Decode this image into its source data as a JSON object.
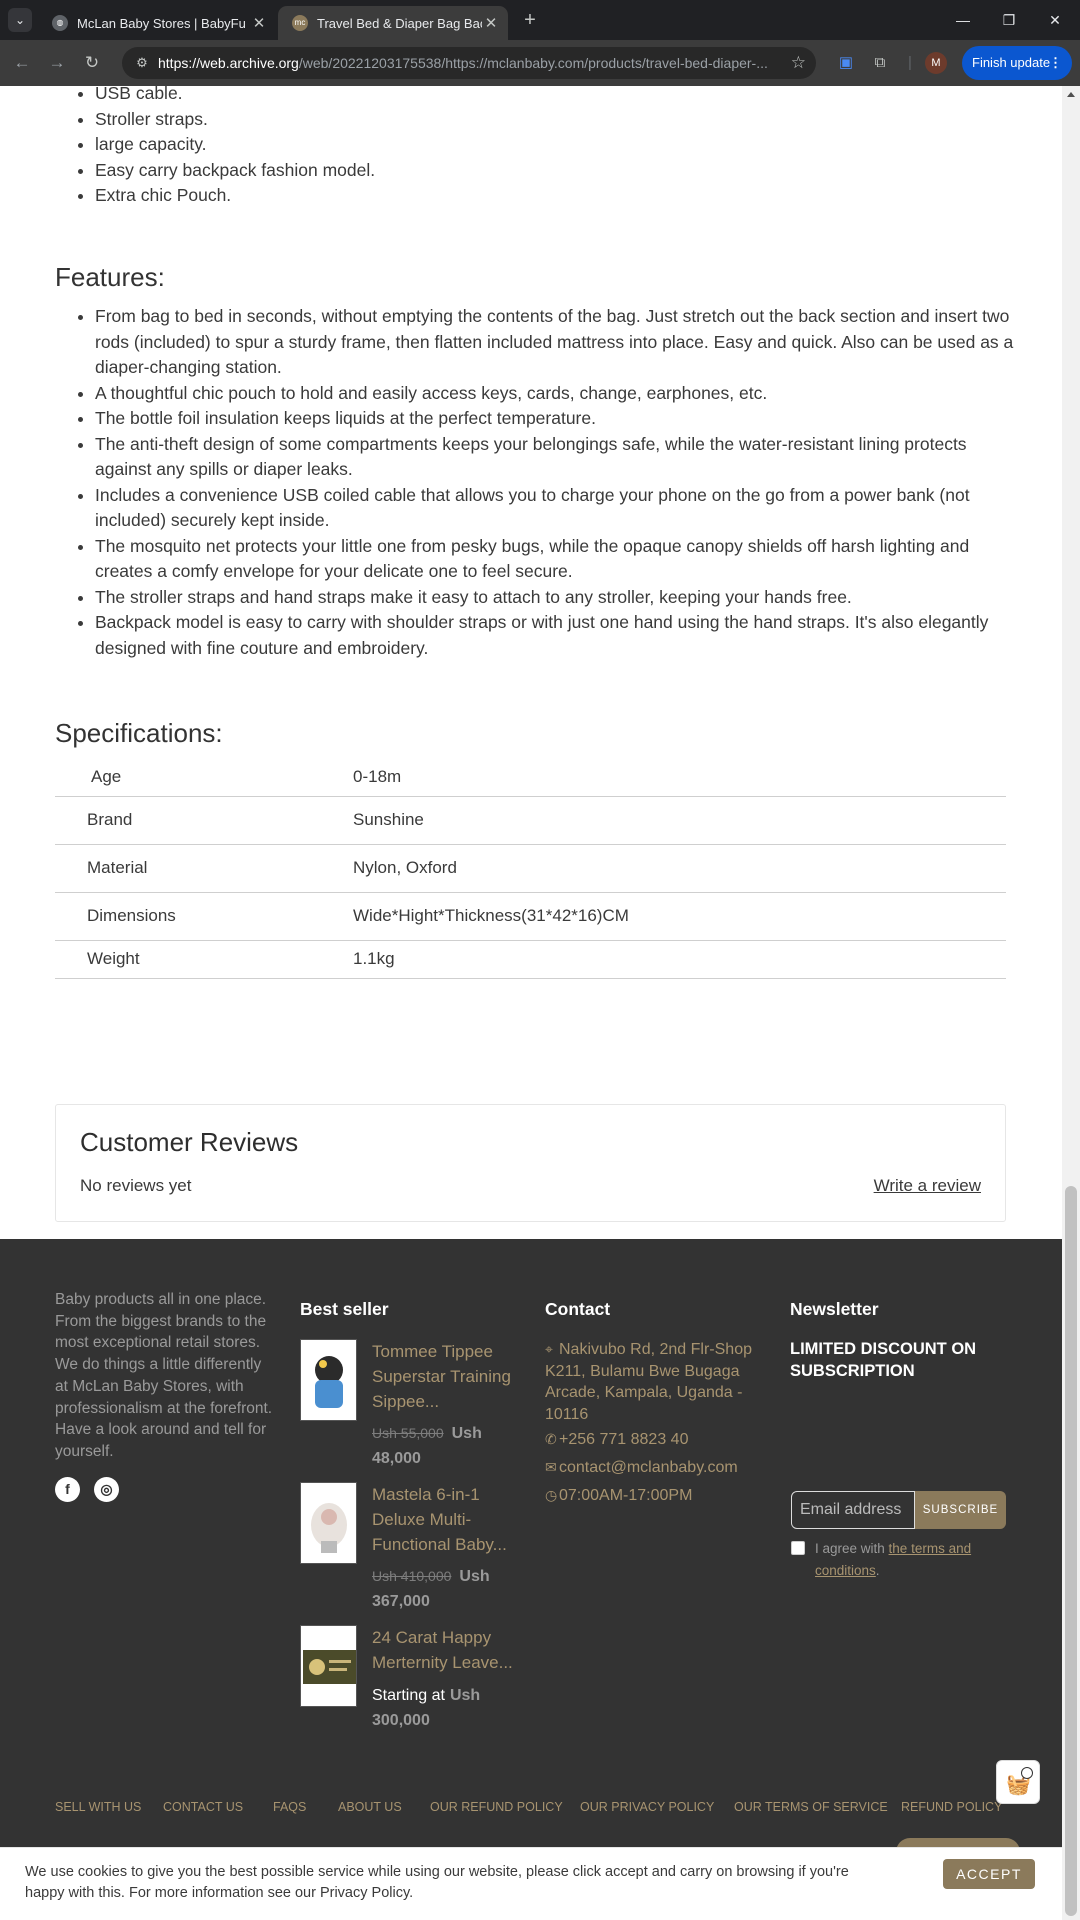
{
  "browser": {
    "tabs": [
      {
        "title": "McLan Baby Stores | BabyFu - M",
        "favicon": "globe-icon"
      },
      {
        "title": "Travel Bed & Diaper Bag Backpack",
        "favicon": "mc"
      }
    ],
    "url_host": "https://web.archive.org",
    "url_path": "/web/20221203175538/https://mclanbaby.com/products/travel-bed-diaper-...",
    "profile_initial": "M",
    "finish_update_label": "Finish update"
  },
  "page": {
    "top_list": [
      "USB cable.",
      "Stroller straps.",
      "large capacity.",
      "Easy carry backpack fashion model.",
      "Extra chic Pouch."
    ],
    "features_heading": "Features:",
    "features": [
      "From bag to bed in seconds, without emptying the contents of the bag. Just stretch out the back section and insert two rods (included) to spur a sturdy frame, then flatten included mattress into place. Easy and quick. Also can be used as a diaper-changing station.",
      "A thoughtful chic pouch to hold and easily access keys, cards, change, earphones, etc.",
      "The bottle foil insulation keeps liquids at the perfect temperature.",
      "The anti-theft design of some compartments keeps your belongings safe, while the water-resistant lining protects against any spills or diaper leaks.",
      "Includes a convenience USB coiled cable that allows you to charge your phone on the go from a power bank (not included) securely kept inside.",
      "The mosquito net protects your little one from pesky bugs, while the opaque canopy shields off harsh lighting and creates a comfy envelope for your delicate one to feel secure.",
      "The stroller straps and hand straps make it easy to attach to any stroller, keeping your hands free.",
      "Backpack model is easy to carry with shoulder straps or with just one hand using the hand straps. It's also elegantly designed with fine couture and embroidery."
    ],
    "specs_heading": "Specifications:",
    "specs": [
      {
        "label": "Age",
        "value": "0-18m"
      },
      {
        "label": "Brand",
        "value": "Sunshine"
      },
      {
        "label": "Material",
        "value": "Nylon, Oxford"
      },
      {
        "label": "Dimensions",
        "value": "Wide*Hight*Thickness(31*42*16)CM"
      },
      {
        "label": "Weight",
        "value": "1.1kg"
      }
    ],
    "reviews": {
      "title": "Customer Reviews",
      "empty": "No reviews yet",
      "write_link": "Write a review"
    }
  },
  "footer": {
    "about": "Baby products all in one place. From the biggest brands to the most exceptional retail stores. We do things a little differently at McLan Baby Stores, with professionalism at the forefront. Have a look around and tell for yourself.",
    "bestseller_heading": "Best seller",
    "products": [
      {
        "name": "Tommee Tippee Superstar Training Sippee...",
        "old_price": "Ush 55,000",
        "price": "Ush 48,000",
        "prefix": ""
      },
      {
        "name": "Mastela 6-in-1 Deluxe Multi-Functional Baby...",
        "old_price": "Ush 410,000",
        "price": "Ush 367,000",
        "prefix": ""
      },
      {
        "name": "24 Carat Happy Merternity Leave...",
        "old_price": "",
        "price": "Ush 300,000",
        "prefix": "Starting at"
      }
    ],
    "contact_heading": "Contact",
    "address": "Nakivubo Rd, 2nd Flr-Shop K211, Bulamu Bwe Bugaga Arcade, Kampala, Uganda - 10116",
    "phone": "+256 771 8823 40",
    "email": "contact@mclanbaby.com",
    "hours": "07:00AM-17:00PM",
    "newsletter_heading": "Newsletter",
    "newsletter_sub": "LIMITED DISCOUNT ON SUBSCRIPTION",
    "email_placeholder": "Email address",
    "subscribe_label": "SUBSCRIBE",
    "agree_prefix": "I agree with ",
    "agree_link": "the terms and conditions",
    "agree_suffix": ".",
    "nav": [
      "SELL WITH US",
      "CONTACT US",
      "FAQS",
      "ABOUT US",
      "OUR REFUND POLICY",
      "OUR PRIVACY POLICY",
      "OUR TERMS OF SERVICE",
      "REFUND POLICY"
    ]
  },
  "cookie": {
    "message": "We use cookies to give you the best possible service while using our website, please click accept and carry on browsing if you're happy with this. For more information see our Privacy Policy.",
    "accept_label": "ACCEPT"
  },
  "colors": {
    "accent": "#8b7a5b",
    "footer_bg": "#333333",
    "link_gold": "#a89470",
    "browser_blue": "#0b57d0"
  }
}
